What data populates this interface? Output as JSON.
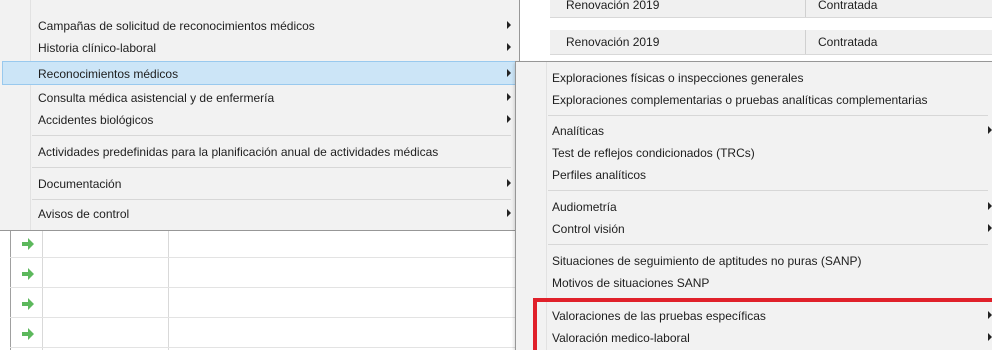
{
  "background_table": {
    "rows": [
      {
        "name": "Renovación 2019",
        "status": "Contratada"
      },
      {
        "name": "Renovación 2019",
        "status": "Contratada"
      }
    ]
  },
  "menu_main": {
    "items": [
      {
        "label": "Campañas de solicitud de reconocimientos médicos",
        "submenu": true
      },
      {
        "label": "Historia clínico-laboral",
        "submenu": true
      },
      {
        "label": "Reconocimientos médicos",
        "submenu": true,
        "highlighted": true
      },
      {
        "label": "Consulta médica asistencial y de enfermería",
        "submenu": true
      },
      {
        "label": "Accidentes biológicos",
        "submenu": true
      },
      {
        "label": "Actividades predefinidas para la planificación anual de actividades médicas",
        "submenu": false
      },
      {
        "label": "Documentación",
        "submenu": true
      },
      {
        "label": "Avisos de control",
        "submenu": true
      }
    ]
  },
  "menu_sub": {
    "items": [
      {
        "label": "Exploraciones físicas o inspecciones generales",
        "submenu": false
      },
      {
        "label": "Exploraciones complementarias o pruebas analíticas complementarias",
        "submenu": false
      },
      {
        "label": "Analíticas",
        "submenu": true
      },
      {
        "label": "Test de reflejos condicionados (TRCs)",
        "submenu": false
      },
      {
        "label": "Perfiles analíticos",
        "submenu": false
      },
      {
        "label": "Audiometría",
        "submenu": true
      },
      {
        "label": "Control visión",
        "submenu": true
      },
      {
        "label": "Situaciones de seguimiento de aptitudes no puras (SANP)",
        "submenu": false
      },
      {
        "label": "Motivos de situaciones SANP",
        "submenu": false
      },
      {
        "label": "Valoraciones de las pruebas específicas",
        "submenu": true
      },
      {
        "label": "Valoración medico-laboral",
        "submenu": true
      }
    ]
  },
  "colors": {
    "highlight": "#cce5f7",
    "annotation": "#e0202a",
    "arrow": "#5cb85c"
  },
  "icons": [
    "green-arrow-icon",
    "chevron-right-icon"
  ]
}
